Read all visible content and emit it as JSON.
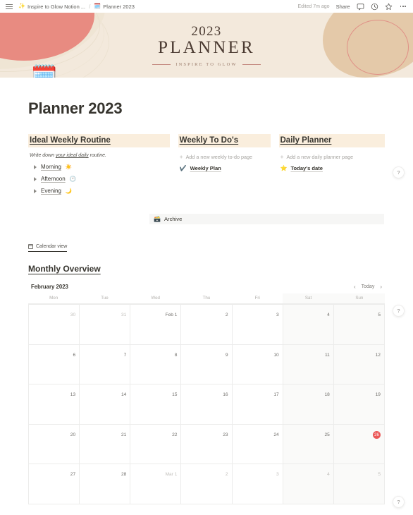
{
  "topbar": {
    "menu_icon": "hamburger-menu-icon",
    "breadcrumb": [
      {
        "emoji": "✨",
        "label": "Inspire to Glow Notion ..."
      },
      {
        "emoji": "🗓️",
        "label": "Planner 2023"
      }
    ],
    "separator": "/",
    "edited": "Edited 7m ago",
    "share_label": "Share",
    "icons": [
      "comment-icon",
      "history-icon",
      "star-icon",
      "more-options-icon"
    ]
  },
  "banner": {
    "year": "2023",
    "word": "PLANNER",
    "subtitle": "INSPIRE TO GLOW",
    "colors": {
      "background": "#f3e9dc",
      "coral": "#e88b81",
      "tan": "#e0c3a0",
      "ring": "#e08f86"
    }
  },
  "page": {
    "emoji": "🗓️",
    "title": "Planner 2023"
  },
  "sections": {
    "routine": {
      "heading": "Ideal Weekly Routine",
      "subtitle_prefix": "Write down ",
      "subtitle_underlined": "your ideal daily",
      "subtitle_suffix": " routine.",
      "items": [
        {
          "label": "Morning",
          "emoji": "☀️"
        },
        {
          "label": "Afternoon",
          "emoji": "🕐"
        },
        {
          "label": "Evening",
          "emoji": "🌙"
        }
      ]
    },
    "weekly_todos": {
      "heading": "Weekly To Do's",
      "add_label": "Add a new weekly to-do page",
      "pages": [
        {
          "emoji": "✔️",
          "label": "Weekly Plan"
        }
      ]
    },
    "daily_planner": {
      "heading": "Daily Planner",
      "add_label": "Add a new daily planner page",
      "pages": [
        {
          "emoji": "⭐",
          "label": "Today's date"
        }
      ]
    }
  },
  "archive": {
    "emoji": "🗃️",
    "label": "Archive"
  },
  "calendar_view_tab": {
    "label": "Calendar view"
  },
  "monthly_overview": {
    "heading": "Monthly Overview"
  },
  "calendar": {
    "month_label": "February 2023",
    "prev_label": "‹",
    "today_label": "Today",
    "next_label": "›",
    "day_headers": [
      "Mon",
      "Tue",
      "Wed",
      "Thu",
      "Fri",
      "Sat",
      "Sun"
    ],
    "weekend_indices": [
      5,
      6
    ],
    "today_color": "#eb5757",
    "weeks": [
      [
        {
          "text": "30",
          "muted": true
        },
        {
          "text": "31",
          "muted": true
        },
        {
          "text": "Feb 1",
          "muted": false
        },
        {
          "text": "2",
          "muted": false
        },
        {
          "text": "3",
          "muted": false
        },
        {
          "text": "4",
          "muted": false
        },
        {
          "text": "5",
          "muted": false
        }
      ],
      [
        {
          "text": "6",
          "muted": false
        },
        {
          "text": "7",
          "muted": false
        },
        {
          "text": "8",
          "muted": false
        },
        {
          "text": "9",
          "muted": false
        },
        {
          "text": "10",
          "muted": false
        },
        {
          "text": "11",
          "muted": false
        },
        {
          "text": "12",
          "muted": false
        }
      ],
      [
        {
          "text": "13",
          "muted": false
        },
        {
          "text": "14",
          "muted": false
        },
        {
          "text": "15",
          "muted": false
        },
        {
          "text": "16",
          "muted": false
        },
        {
          "text": "17",
          "muted": false
        },
        {
          "text": "18",
          "muted": false
        },
        {
          "text": "19",
          "muted": false
        }
      ],
      [
        {
          "text": "20",
          "muted": false
        },
        {
          "text": "21",
          "muted": false
        },
        {
          "text": "22",
          "muted": false
        },
        {
          "text": "23",
          "muted": false
        },
        {
          "text": "24",
          "muted": false
        },
        {
          "text": "25",
          "muted": false
        },
        {
          "text": "26",
          "muted": false,
          "today": true
        }
      ],
      [
        {
          "text": "27",
          "muted": false
        },
        {
          "text": "28",
          "muted": false
        },
        {
          "text": "Mar 1",
          "muted": true
        },
        {
          "text": "2",
          "muted": true
        },
        {
          "text": "3",
          "muted": true
        },
        {
          "text": "4",
          "muted": true
        },
        {
          "text": "5",
          "muted": true
        }
      ]
    ]
  },
  "help_buttons": {
    "label": "?"
  }
}
